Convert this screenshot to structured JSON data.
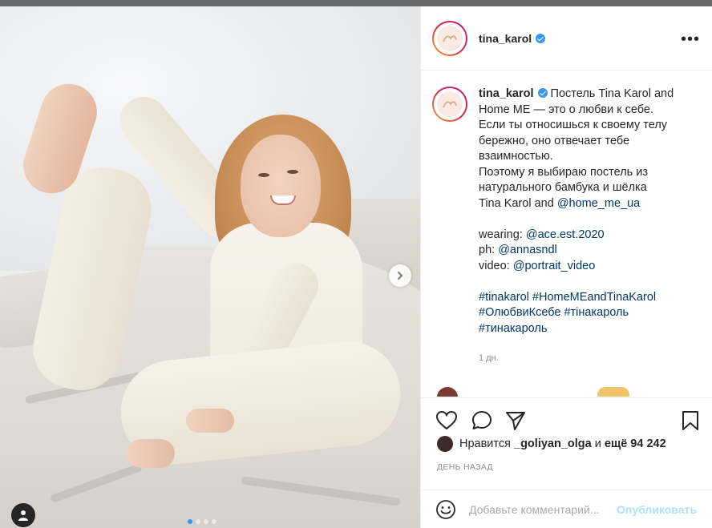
{
  "post": {
    "username": "tina_karol",
    "caption_lines": [
      "Постель Tina Karol and",
      "Home ME — это о любви к себе.",
      "Если ты относишься к своему телу",
      "бережно, оно отвечает тебе",
      "взаимностью.",
      "Поэтому я выбираю постель из",
      "натурального бамбука и шёлка",
      "Tina Karol and "
    ],
    "home_me_mention": "@home_me_ua",
    "credits": [
      {
        "label": "wearing: ",
        "mention": "@ace.est.2020"
      },
      {
        "label": "ph: ",
        "mention": "@annasndl"
      },
      {
        "label": "video: ",
        "mention": "@portrait_video"
      }
    ],
    "hashtags_line1": [
      "#tinakarol",
      "#HomeMEandTinaKarol"
    ],
    "hashtags_line2": [
      "#ОлюбвиКсебе",
      "#тінакароль"
    ],
    "hashtags_line3": [
      "#тинакароль"
    ],
    "caption_time": "1 дн.",
    "likes_prefix": "Нравится ",
    "likes_user": "_goliyan_olga",
    "likes_mid": " и ",
    "likes_count": "ещё 94 242",
    "date_label": "ДЕНЬ НАЗАД",
    "comment_placeholder": "Добавьте комментарий...",
    "publish_label": "Опубликовать",
    "more_label": "•••"
  },
  "icons": {
    "verified": "verified-badge-icon",
    "heart": "heart-icon",
    "comment": "comment-icon",
    "share": "share-icon",
    "save": "bookmark-icon",
    "emoji": "emoji-icon",
    "next": "chevron-right-icon",
    "tag": "user-tag-icon"
  },
  "colors": {
    "link": "#00376b",
    "verified": "#3897f0",
    "publish_disabled": "#b2dffc"
  },
  "carousel": {
    "count": 4,
    "active_index": 0
  }
}
